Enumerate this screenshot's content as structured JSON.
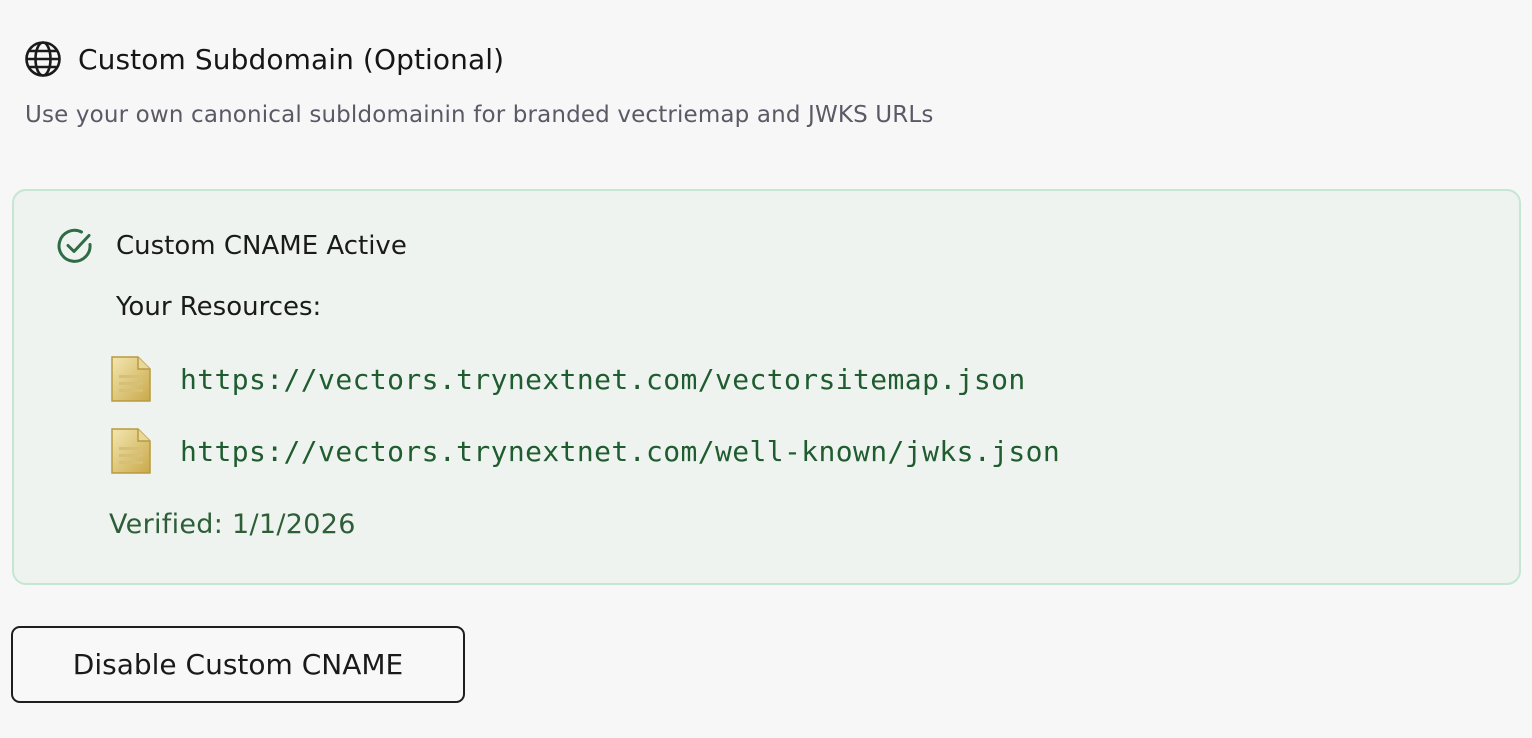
{
  "section": {
    "icon": "globe-icon",
    "title": "Custom Subdomain (Optional)",
    "description": "Use your own canonical subldomainin for branded vectriemap and JWKS URLs"
  },
  "status_card": {
    "icon": "check-circle-icon",
    "status": "Custom CNAME Active",
    "resources_label": "Your Resources:",
    "resources": [
      {
        "icon": "document-icon",
        "url": "https://vectors.trynextnet.com/vectorsitemap.json"
      },
      {
        "icon": "document-icon",
        "url": "https://vectors.trynextnet.com/well-known/jwks.json"
      }
    ],
    "verified": "Verified: 1/1/2026"
  },
  "actions": {
    "disable_label": "Disable Custom CNAME"
  },
  "colors": {
    "card_background": "#eef3ef",
    "card_border": "#c4e6d2",
    "link": "#1f5c2f",
    "success": "#2f6b44"
  }
}
